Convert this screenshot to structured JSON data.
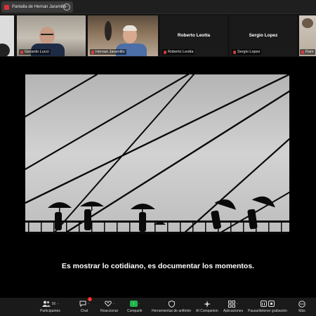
{
  "topbar": {
    "share_label": "Pantalla de Hernan Jaramillo",
    "more_glyph": "⋯"
  },
  "gallery": {
    "tiles": [
      {
        "name": "Gerardo Lucci",
        "has_video": true,
        "muted": true
      },
      {
        "name": "Hernan Jaramillo",
        "has_video": true,
        "muted": true,
        "active_speaker": true
      },
      {
        "name": "Roberto Leotta",
        "has_video": false,
        "muted": true
      },
      {
        "name": "Sergio Lopez",
        "has_video": false,
        "muted": true
      },
      {
        "name": "Ram",
        "has_video": true,
        "muted": true
      }
    ]
  },
  "shared_content": {
    "caption": "Es mostrar lo cotidiano, es documentar los momentos."
  },
  "toolbar": {
    "participants": {
      "label": "Participantes",
      "count": "56",
      "icon": "participants-icon"
    },
    "chat": {
      "label": "Chat",
      "badge": "1",
      "icon": "chat-icon"
    },
    "reactions": {
      "label": "Reaccionar",
      "icon": "heart-icon"
    },
    "share": {
      "label": "Compartir",
      "icon": "share-screen-icon"
    },
    "host_tools": {
      "label": "Herramientas de anfitrión",
      "icon": "shield-icon"
    },
    "companion": {
      "label": "AI Companion",
      "icon": "sparkle-icon"
    },
    "apps": {
      "label": "Aplicaciones",
      "icon": "apps-icon"
    },
    "recording": {
      "label": "Pausa/detener grabación",
      "icon": "recording-icon"
    },
    "more": {
      "label": "Más",
      "icon": "more-icon"
    }
  },
  "colors": {
    "active_speaker": "#25c066",
    "share_button": "#22b24c",
    "mute_red": "#e0393e",
    "record_red": "#d8323c"
  }
}
